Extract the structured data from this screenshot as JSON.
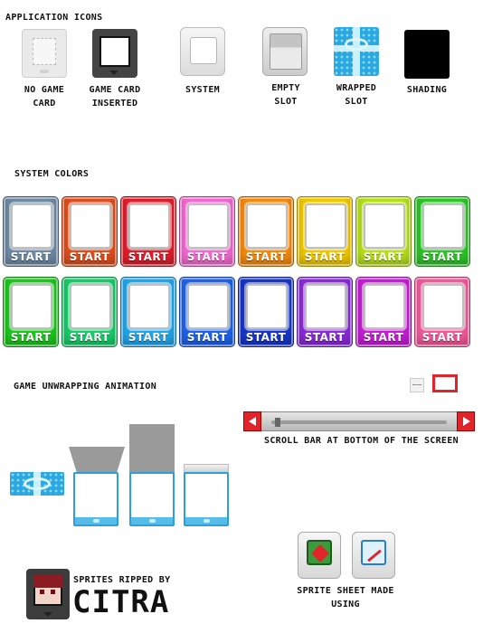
{
  "sections": {
    "application_icons": "APPLICATION ICONS",
    "system_colors": "SYSTEM COLORS",
    "game_unwrapping": "GAME UNWRAPPING ANIMATION"
  },
  "app_icons": [
    {
      "name": "no-game-card",
      "label": "NO GAME CARD"
    },
    {
      "name": "game-card-inserted",
      "label": "GAME CARD INSERTED"
    },
    {
      "name": "system",
      "label": "SYSTEM"
    },
    {
      "name": "empty-slot",
      "label": "EMPTY SLOT"
    },
    {
      "name": "wrapped-slot",
      "label": "WRAPPED SLOT"
    },
    {
      "name": "shading",
      "label": "SHADING"
    }
  ],
  "start_label": "START",
  "system_colors_row1": [
    "#6f8aa6",
    "#e04e1c",
    "#e01e2a",
    "#f36ad0",
    "#f58a10",
    "#f0c800",
    "#b6e01a",
    "#2ec42a"
  ],
  "system_colors_row2": [
    "#1ec61e",
    "#1acb6a",
    "#22a6ea",
    "#1f62e8",
    "#1736c8",
    "#8a2ad8",
    "#c41ed4",
    "#f05a9a"
  ],
  "scroll_bar_caption": "SCROLL BAR AT BOTTOM OF THE SCREEN",
  "credits": {
    "ripped_by": "SPRITES RIPPED BY",
    "tool_name": "CITRA",
    "made_using": "SPRITE SHEET MADE USING"
  }
}
